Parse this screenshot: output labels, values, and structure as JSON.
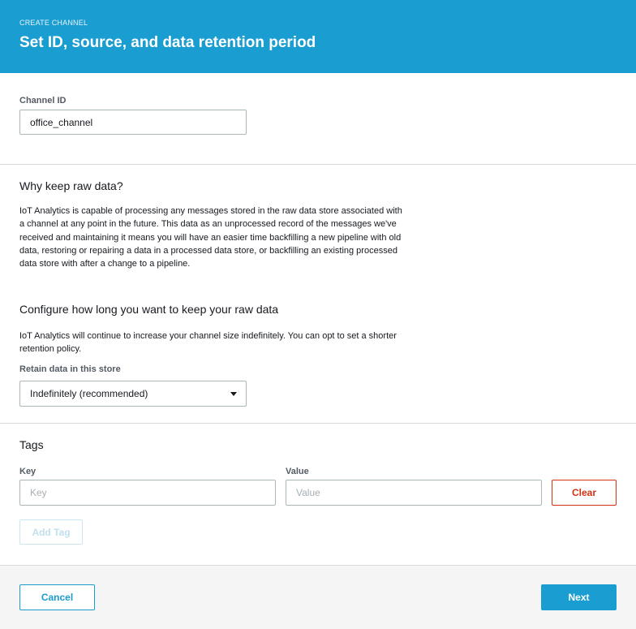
{
  "header": {
    "eyebrow": "CREATE CHANNEL",
    "title": "Set ID, source, and data retention period"
  },
  "channel": {
    "label": "Channel ID",
    "value": "office_channel"
  },
  "raw_data": {
    "heading": "Why keep raw data?",
    "body": "IoT Analytics is capable of processing any messages stored in the raw data store associated with a channel at any point in the future. This data as an unprocessed record of the messages we've received and maintaining it means you will have an easier time backfilling a new pipeline with old data, restoring or repairing a data in a processed data store, or backfilling an existing processed data store with after a change to a pipeline."
  },
  "retention": {
    "heading": "Configure how long you want to keep your raw data",
    "body": "IoT Analytics will continue to increase your channel size indefinitely. You can opt to set a shorter retention policy.",
    "label": "Retain data in this store",
    "selected": "Indefinitely (recommended)"
  },
  "tags": {
    "heading": "Tags",
    "key_label": "Key",
    "key_placeholder": "Key",
    "value_label": "Value",
    "value_placeholder": "Value",
    "clear_label": "Clear",
    "add_label": "Add Tag"
  },
  "footer": {
    "cancel_label": "Cancel",
    "next_label": "Next"
  },
  "colors": {
    "accent": "#1a9dd0",
    "danger": "#d13212"
  }
}
